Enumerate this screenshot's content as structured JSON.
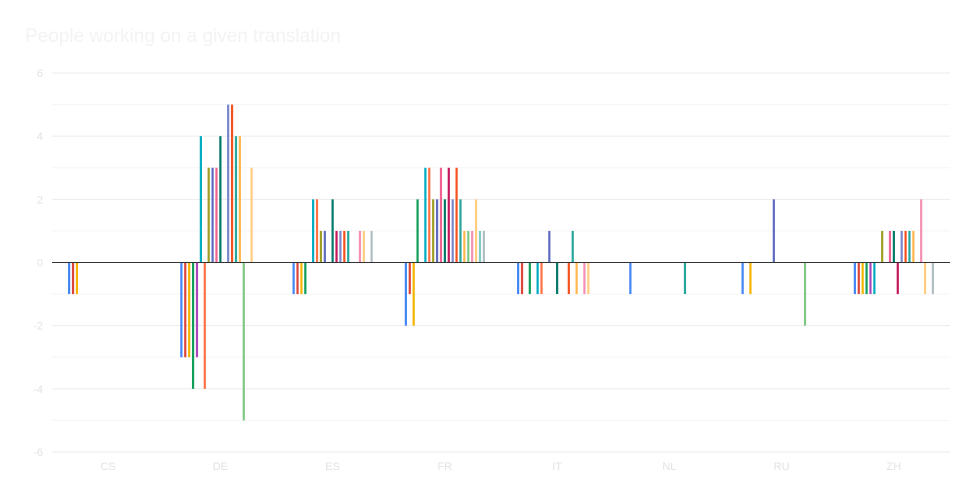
{
  "chart_data": {
    "type": "bar",
    "title": "People working on a given translation",
    "categories": [
      "CS",
      "DE",
      "ES",
      "FR",
      "IT",
      "NL",
      "RU",
      "ZH"
    ],
    "ylim": [
      -6,
      6
    ],
    "yticks": [
      6,
      4,
      2,
      0,
      -2,
      -4,
      -6
    ],
    "ytick_labels": [
      "6",
      "4",
      "2",
      "0",
      "-2",
      "-4",
      "-6"
    ],
    "grid": true,
    "legend": "none",
    "series": [
      {
        "color": "#4285f4",
        "values": [
          -1,
          -3,
          -1,
          -2,
          -1,
          -1,
          -1,
          -1
        ]
      },
      {
        "color": "#db4437",
        "values": [
          -1,
          -3,
          -1,
          -1,
          -1,
          0,
          0,
          -1
        ]
      },
      {
        "color": "#f4b400",
        "values": [
          -1,
          -3,
          -1,
          -2,
          0,
          0,
          -1,
          -1
        ]
      },
      {
        "color": "#0f9d58",
        "values": [
          0,
          -4,
          -1,
          2,
          -1,
          0,
          0,
          -1
        ]
      },
      {
        "color": "#ab47bc",
        "values": [
          0,
          -3,
          0,
          0,
          0,
          0,
          0,
          -1
        ]
      },
      {
        "color": "#00acc1",
        "values": [
          0,
          4,
          2,
          3,
          -1,
          0,
          0,
          -1
        ]
      },
      {
        "color": "#ff7043",
        "values": [
          0,
          -4,
          2,
          3,
          -1,
          0,
          0,
          0
        ]
      },
      {
        "color": "#9e9d24",
        "values": [
          0,
          3,
          1,
          2,
          0,
          0,
          0,
          1
        ]
      },
      {
        "color": "#5c6bc0",
        "values": [
          0,
          3,
          1,
          2,
          1,
          0,
          2,
          0
        ]
      },
      {
        "color": "#f06292",
        "values": [
          0,
          3,
          0,
          3,
          0,
          0,
          0,
          1
        ]
      },
      {
        "color": "#00796b",
        "values": [
          0,
          4,
          2,
          2,
          -1,
          0,
          0,
          1
        ]
      },
      {
        "color": "#c2185b",
        "values": [
          0,
          0,
          1,
          3,
          0,
          0,
          0,
          -1
        ]
      },
      {
        "color": "#7986cb",
        "values": [
          0,
          5,
          1,
          2,
          0,
          0,
          0,
          1
        ]
      },
      {
        "color": "#f4511e",
        "values": [
          0,
          5,
          1,
          3,
          -1,
          0,
          0,
          1
        ]
      },
      {
        "color": "#26a69a",
        "values": [
          0,
          4,
          1,
          2,
          1,
          -1,
          0,
          1
        ]
      },
      {
        "color": "#ffb74d",
        "values": [
          0,
          4,
          0,
          1,
          -1,
          0,
          0,
          1
        ]
      },
      {
        "color": "#81c784",
        "values": [
          0,
          -5,
          0,
          1,
          0,
          0,
          -2,
          0
        ]
      },
      {
        "color": "#f48fb1",
        "values": [
          0,
          0,
          1,
          1,
          -1,
          0,
          0,
          2
        ]
      },
      {
        "color": "#ffcc80",
        "values": [
          0,
          3,
          1,
          2,
          -1,
          0,
          0,
          -1
        ]
      },
      {
        "color": "#80cbc4",
        "values": [
          0,
          0,
          0,
          1,
          0,
          0,
          0,
          0
        ]
      },
      {
        "color": "#b0bec5",
        "values": [
          0,
          0,
          1,
          1,
          0,
          0,
          0,
          -1
        ]
      }
    ]
  }
}
